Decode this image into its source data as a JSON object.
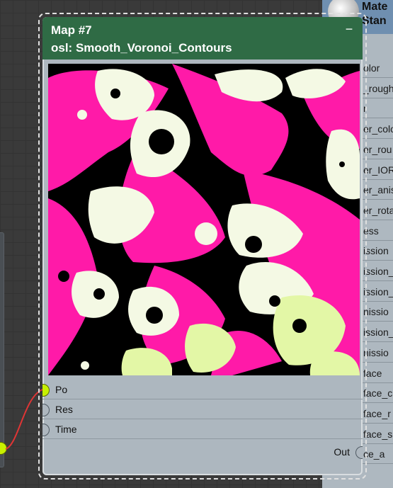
{
  "editor": {
    "background_color": "#3a3a3a"
  },
  "main_node": {
    "title": "Map #7",
    "subtitle": "osl: Smooth_Voronoi_Contours",
    "header_color": "#2f6b45",
    "collapse_icon": "minus-icon",
    "inputs": [
      {
        "label": "Po",
        "connected": true
      },
      {
        "label": "Res",
        "connected": false
      },
      {
        "label": "Time",
        "connected": false
      }
    ],
    "output": {
      "label": "Out"
    },
    "preview_colors": {
      "pink": "#ff1aa8",
      "black": "#000000",
      "cream": "#f4f9e4",
      "lime": "#e3f7a6"
    }
  },
  "right_node": {
    "title_line1": "Mate",
    "title_line2": "Stan",
    "rows": [
      "olor",
      "_rough",
      "r",
      "er_colo",
      "er_rou",
      "er_IOR",
      "er_anis",
      "er_rota",
      "ess",
      "ission",
      "ission_",
      "ission_",
      "nissio",
      "ission_",
      "nissio",
      "face",
      "face_c",
      "face_r",
      "face_s",
      "ce_a"
    ]
  }
}
